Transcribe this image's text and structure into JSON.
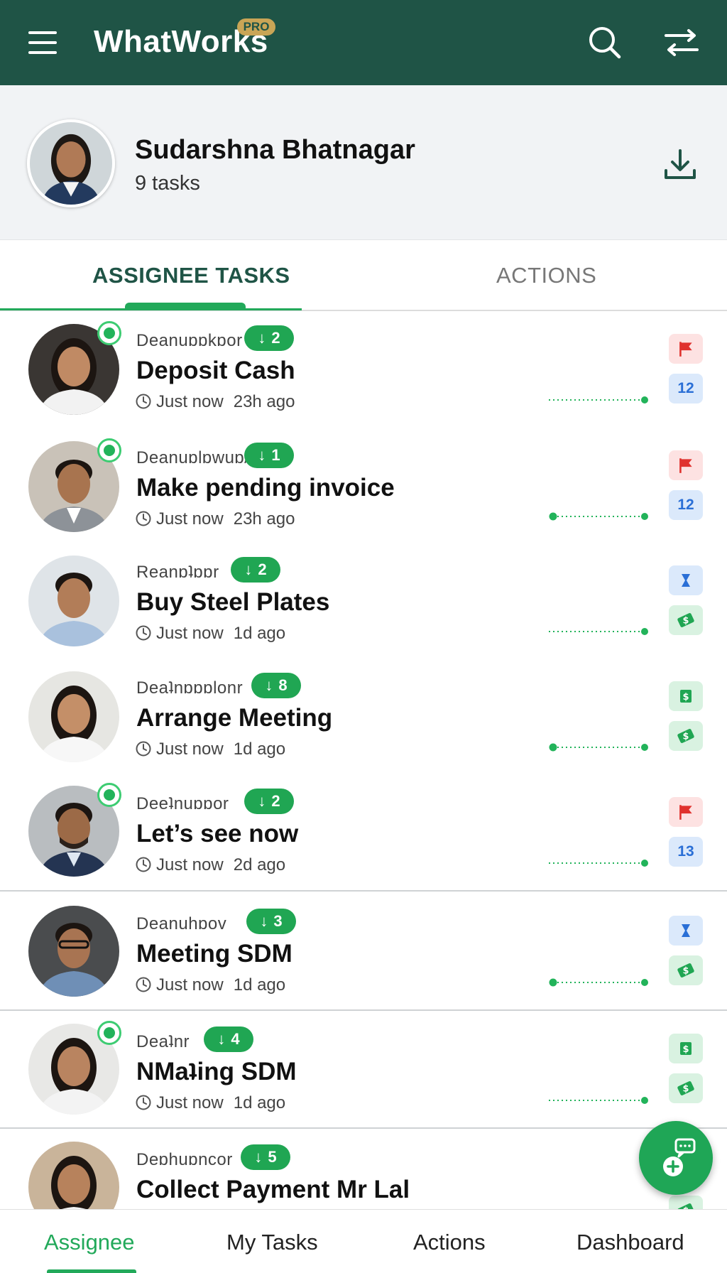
{
  "app": {
    "title": "WhatWorks",
    "badge": "PRO",
    "colors": {
      "primary": "#1f5446",
      "accent": "#22a95a"
    }
  },
  "profile": {
    "name": "Sudarshna Bhatnagar",
    "task_count": "9 tasks"
  },
  "tabs": [
    {
      "label": "ASSIGNEE TASKS",
      "active": true
    },
    {
      "label": "ACTIONS",
      "active": false
    }
  ],
  "tasks": [
    {
      "assigner": "Deanuɒɒkɒor",
      "count": "2",
      "title": "Deposit Cash",
      "time": "Just now",
      "ago": "23h ago",
      "online": true,
      "tags": [
        "flag",
        "12"
      ]
    },
    {
      "assigner": "Deanuɒlɒwuɒ/",
      "count": "1",
      "title": "Make pending invoice",
      "time": "Just now",
      "ago": "23h ago",
      "online": true,
      "tags": [
        "flag",
        "12"
      ]
    },
    {
      "assigner": "Reanɒʇɒɒr",
      "count": "2",
      "title": "Buy Steel Plates",
      "time": "Just now",
      "ago": "1d ago",
      "online": false,
      "tags": [
        "hourglass",
        "money"
      ]
    },
    {
      "assigner": "Deaʇnɒɒɒlonr",
      "count": "8",
      "title": "Arrange Meeting",
      "time": "Just now",
      "ago": "1d ago",
      "online": false,
      "tags": [
        "cash",
        "money"
      ]
    },
    {
      "assigner": "Deeʇnuɒɒor",
      "count": "2",
      "title": "Let’s see now",
      "time": "Just now",
      "ago": "2d ago",
      "online": true,
      "tags": [
        "flag",
        "13"
      ]
    },
    {
      "assigner": "Deanuhɒov",
      "count": "3",
      "title": "Meeting SDM",
      "time": "Just now",
      "ago": "1d ago",
      "online": false,
      "tags": [
        "hourglass",
        "money"
      ]
    },
    {
      "assigner": "Deaʇnr",
      "count": "4",
      "title": "NMaʇing SDM",
      "time": "Just now",
      "ago": "1d ago",
      "online": true,
      "tags": [
        "cash",
        "money"
      ]
    },
    {
      "assigner": "Deɒhuɒncor",
      "count": "5",
      "title": "Collect Payment Mr Lal",
      "time": "",
      "ago": "",
      "online": false,
      "tags": [
        "money"
      ]
    }
  ],
  "bottom_nav": [
    {
      "label": "Assignee",
      "active": true
    },
    {
      "label": "My Tasks",
      "active": false
    },
    {
      "label": "Actions",
      "active": false
    },
    {
      "label": "Dashboard",
      "active": false
    }
  ],
  "icons": {
    "menu": "menu-icon",
    "search": "search-icon",
    "switch": "swap-icon",
    "download": "download-icon",
    "clock": "clock-icon",
    "flag": "flag-icon",
    "hourglass": "hourglass-icon",
    "cash": "cash-icon",
    "money": "money-icon",
    "fab": "chat-add-icon"
  }
}
